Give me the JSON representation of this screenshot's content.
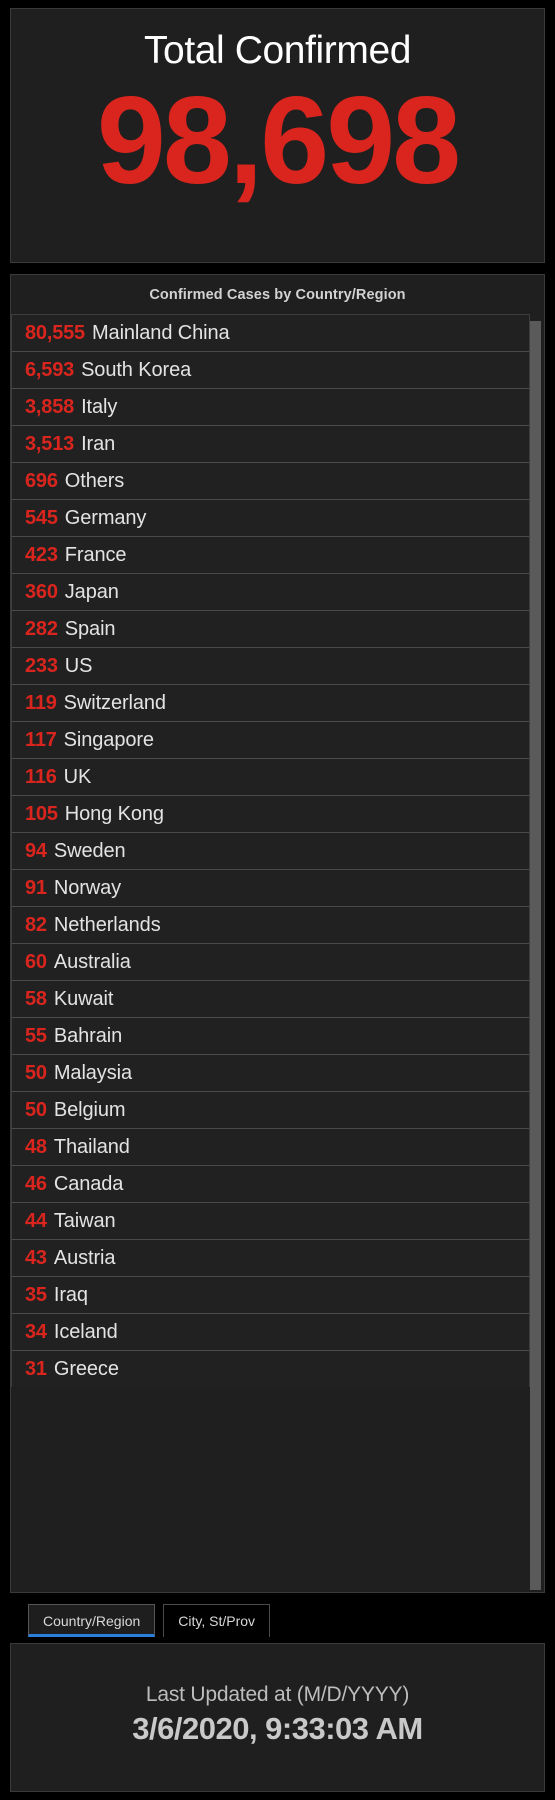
{
  "total": {
    "title": "Total Confirmed",
    "value": "98,698",
    "color": "#d9251d"
  },
  "list": {
    "header": "Confirmed Cases by Country/Region",
    "rows": [
      {
        "count": "80,555",
        "name": "Mainland China"
      },
      {
        "count": "6,593",
        "name": "South Korea"
      },
      {
        "count": "3,858",
        "name": "Italy"
      },
      {
        "count": "3,513",
        "name": "Iran"
      },
      {
        "count": "696",
        "name": "Others"
      },
      {
        "count": "545",
        "name": "Germany"
      },
      {
        "count": "423",
        "name": "France"
      },
      {
        "count": "360",
        "name": "Japan"
      },
      {
        "count": "282",
        "name": "Spain"
      },
      {
        "count": "233",
        "name": "US"
      },
      {
        "count": "119",
        "name": "Switzerland"
      },
      {
        "count": "117",
        "name": "Singapore"
      },
      {
        "count": "116",
        "name": "UK"
      },
      {
        "count": "105",
        "name": "Hong Kong"
      },
      {
        "count": "94",
        "name": "Sweden"
      },
      {
        "count": "91",
        "name": "Norway"
      },
      {
        "count": "82",
        "name": "Netherlands"
      },
      {
        "count": "60",
        "name": "Australia"
      },
      {
        "count": "58",
        "name": "Kuwait"
      },
      {
        "count": "55",
        "name": "Bahrain"
      },
      {
        "count": "50",
        "name": "Malaysia"
      },
      {
        "count": "50",
        "name": "Belgium"
      },
      {
        "count": "48",
        "name": "Thailand"
      },
      {
        "count": "46",
        "name": "Canada"
      },
      {
        "count": "44",
        "name": "Taiwan"
      },
      {
        "count": "43",
        "name": "Austria"
      },
      {
        "count": "35",
        "name": "Iraq"
      },
      {
        "count": "34",
        "name": "Iceland"
      },
      {
        "count": "31",
        "name": "Greece"
      }
    ]
  },
  "tabs": [
    {
      "label": "Country/Region",
      "active": true
    },
    {
      "label": "City, St/Prov",
      "active": false
    }
  ],
  "footer": {
    "label": "Last Updated at (M/D/YYYY)",
    "timestamp": "3/6/2020, 9:33:03 AM"
  },
  "colors": {
    "accent_red": "#d9251d",
    "panel_bg": "#1f1f1f",
    "page_bg": "#000000",
    "tab_active_underline": "#2a7fdb"
  }
}
